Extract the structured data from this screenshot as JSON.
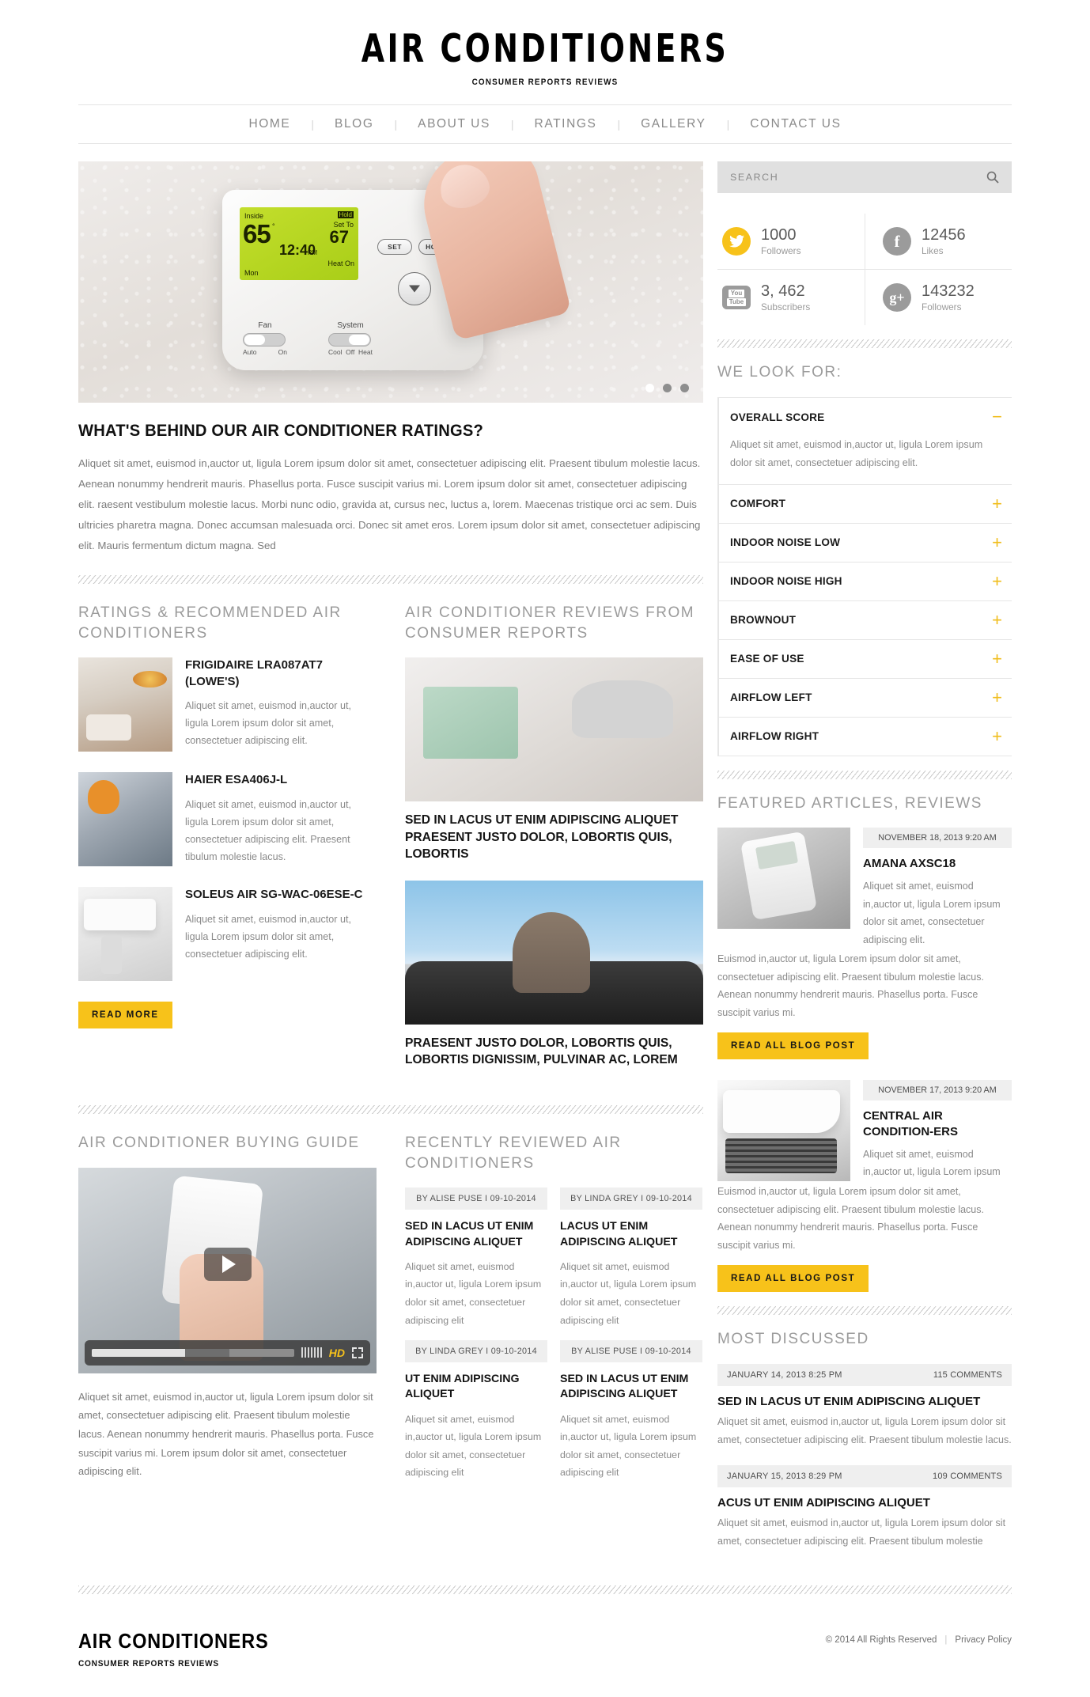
{
  "site": {
    "title": "AIR CONDITIONERS",
    "tagline": "CONSUMER REPORTS REVIEWS"
  },
  "nav": {
    "items": [
      {
        "label": "HOME"
      },
      {
        "label": "BLOG"
      },
      {
        "label": "ABOUT US"
      },
      {
        "label": "RATINGS"
      },
      {
        "label": "GALLERY"
      },
      {
        "label": "CONTACT US"
      }
    ],
    "separator": "|"
  },
  "slider": {
    "thermostat": {
      "inside_label": "Inside",
      "inside_temp": "65",
      "degree": "°",
      "time": "12:40",
      "meridiem": "PM",
      "hold": "Hold",
      "set_to_label": "Set To",
      "set_temp": "67",
      "heat_status": "Heat On",
      "day": "Mon",
      "btn_set": "SET",
      "btn_hold": "HOLD",
      "fan_label": "Fan",
      "fan_options": [
        "Auto",
        "On"
      ],
      "system_label": "System",
      "system_options": [
        "Cool",
        "Off",
        "Heat"
      ]
    },
    "dots": [
      {
        "active": true
      },
      {
        "active": false
      },
      {
        "active": false
      }
    ]
  },
  "intro": {
    "heading": "WHAT'S BEHIND OUR AIR CONDITIONER RATINGS?",
    "body": "Aliquet sit amet, euismod in,auctor ut, ligula Lorem ipsum dolor sit amet, consectetuer adipiscing elit. Praesent tibulum molestie lacus. Aenean nonummy hendrerit mauris. Phasellus porta. Fusce suscipit varius mi. Lorem ipsum dolor sit amet, consectetuer adipiscing elit. raesent vestibulum molestie lacus. Morbi nunc odio, gravida at, cursus nec, luctus a, lorem. Maecenas tristique orci ac sem. Duis ultricies pharetra magna. Donec accumsan malesuada orci. Donec sit amet eros. Lorem ipsum dolor sit amet, consectetuer adipiscing elit. Mauris fermentum dictum magna. Sed"
  },
  "ratings": {
    "heading": "RATINGS & RECOMMENDED AIR CONDITIONERS",
    "items": [
      {
        "title": "FRIGIDAIRE LRA087AT7 (LOWE'S)",
        "desc": "Aliquet sit amet, euismod in,auctor ut, ligula Lorem ipsum dolor sit amet, consectetuer adipiscing elit."
      },
      {
        "title": "HAIER ESA406J-L",
        "desc": "Aliquet sit amet, euismod in,auctor ut, ligula Lorem ipsum dolor sit amet, consectetuer adipiscing elit. Praesent tibulum molestie lacus."
      },
      {
        "title": "SOLEUS AIR SG-WAC-06ESE-C",
        "desc": "Aliquet sit amet, euismod in,auctor ut, ligula Lorem ipsum dolor sit amet, consectetuer adipiscing elit."
      }
    ],
    "read_more": "READ MORE"
  },
  "reviews": {
    "heading": "AIR CONDITIONER REVIEWS FROM CONSUMER REPORTS",
    "items": [
      {
        "title": "SED IN LACUS UT ENIM ADIPISCING ALIQUET PRAESENT JUSTO DOLOR, LOBORTIS QUIS, LOBORTIS"
      },
      {
        "title": "PRAESENT JUSTO DOLOR, LOBORTIS QUIS, LOBORTIS DIGNISSIM, PULVINAR AC, LOREM"
      }
    ]
  },
  "buying_guide": {
    "heading": "AIR CONDITIONER BUYING GUIDE",
    "video": {
      "hd_badge": "HD",
      "progress_played": 46,
      "progress_buffered": 68
    },
    "body": "Aliquet sit amet, euismod in,auctor ut, ligula Lorem ipsum dolor sit amet, consectetuer adipiscing elit. Praesent tibulum molestie lacus. Aenean nonummy hendrerit mauris. Phasellus porta. Fusce suscipit varius mi. Lorem ipsum dolor sit amet, consectetuer adipiscing elit."
  },
  "recently_reviewed": {
    "heading": "RECENTLY REVIEWED AIR CONDITIONERS",
    "items": [
      {
        "meta": "BY ALISE PUSE I 09-10-2014",
        "title": "SED IN LACUS UT ENIM ADIPISCING ALIQUET",
        "desc": "Aliquet sit amet, euismod in,auctor ut, ligula Lorem ipsum dolor sit amet, consectetuer adipiscing elit"
      },
      {
        "meta": "BY LINDA GREY I 09-10-2014",
        "title": "LACUS UT ENIM ADIPISCING ALIQUET",
        "desc": "Aliquet sit amet, euismod in,auctor ut, ligula Lorem ipsum dolor sit amet, consectetuer adipiscing elit"
      },
      {
        "meta": "BY LINDA GREY I 09-10-2014",
        "title": "UT ENIM ADIPISCING ALIQUET",
        "desc": "Aliquet sit amet, euismod in,auctor ut, ligula Lorem ipsum dolor sit amet, consectetuer adipiscing elit"
      },
      {
        "meta": "BY ALISE PUSE I 09-10-2014",
        "title": "SED IN LACUS UT ENIM ADIPISCING ALIQUET",
        "desc": "Aliquet sit amet, euismod in,auctor ut, ligula Lorem ipsum dolor sit amet, consectetuer adipiscing elit"
      }
    ]
  },
  "search": {
    "placeholder": "SEARCH",
    "value": "",
    "icon": "search-icon"
  },
  "social": [
    {
      "network": "twitter",
      "icon": "twitter-icon",
      "count": "1000",
      "label": "Followers",
      "color": "#f7c21a",
      "glyph": "🐦"
    },
    {
      "network": "facebook",
      "icon": "facebook-icon",
      "count": "12456",
      "label": "Likes",
      "color": "#9b9b9b",
      "glyph": "f"
    },
    {
      "network": "youtube",
      "icon": "youtube-icon",
      "count": "3, 462",
      "label": "Subscribers",
      "color": "#9b9b9b",
      "glyph": "You"
    },
    {
      "network": "googleplus",
      "icon": "google-plus-icon",
      "count": "143232",
      "label": "Followers",
      "color": "#9b9b9b",
      "glyph": "g+"
    }
  ],
  "we_look_for": {
    "heading": "WE LOOK FOR:",
    "items": [
      {
        "title": "OVERALL SCORE",
        "open": true,
        "sign": "−",
        "body": "Aliquet sit amet, euismod in,auctor ut, ligula Lorem ipsum dolor sit amet, consectetuer adipiscing elit."
      },
      {
        "title": "COMFORT",
        "open": false,
        "sign": "+",
        "body": ""
      },
      {
        "title": "INDOOR NOISE LOW",
        "open": false,
        "sign": "+",
        "body": ""
      },
      {
        "title": "INDOOR NOISE HIGH",
        "open": false,
        "sign": "+",
        "body": ""
      },
      {
        "title": "BROWNOUT",
        "open": false,
        "sign": "+",
        "body": ""
      },
      {
        "title": "EASE OF USE",
        "open": false,
        "sign": "+",
        "body": ""
      },
      {
        "title": "AIRFLOW LEFT",
        "open": false,
        "sign": "+",
        "body": ""
      },
      {
        "title": "AIRFLOW RIGHT",
        "open": false,
        "sign": "+",
        "body": ""
      }
    ]
  },
  "featured": {
    "heading": "FEATURED ARTICLES, REVIEWS",
    "items": [
      {
        "date": "NOVEMBER 18, 2013 9:20 AM",
        "title": "AMANA AXSC18",
        "excerpt": "Aliquet sit amet, euismod in,auctor ut, ligula Lorem ipsum dolor sit amet, consectetuer adipiscing elit.",
        "more": "Euismod in,auctor ut, ligula Lorem ipsum dolor sit amet, consectetuer adipiscing elit. Praesent tibulum molestie lacus. Aenean nonummy hendrerit mauris. Phasellus porta. Fusce suscipit varius mi.",
        "button": "READ ALL BLOG POST"
      },
      {
        "date": "NOVEMBER 17, 2013 9:20 AM",
        "title": "CENTRAL AIR CONDITION-ERS",
        "excerpt": "Aliquet sit amet, euismod in,auctor ut, ligula Lorem ipsum",
        "more": "Euismod in,auctor ut, ligula Lorem ipsum dolor sit amet, consectetuer adipiscing elit. Praesent tibulum molestie lacus. Aenean nonummy hendrerit mauris. Phasellus porta. Fusce suscipit varius mi.",
        "button": "READ ALL BLOG POST"
      }
    ]
  },
  "most_discussed": {
    "heading": "MOST DISCUSSED",
    "items": [
      {
        "date": "JANUARY 14, 2013 8:25 PM",
        "comments": "115 COMMENTS",
        "title": "SED IN LACUS UT ENIM ADIPISCING ALIQUET",
        "desc": "Aliquet sit amet, euismod in,auctor ut, ligula Lorem ipsum dolor sit amet, consectetuer adipiscing elit. Praesent tibulum molestie lacus."
      },
      {
        "date": "JANUARY 15, 2013 8:29 PM",
        "comments": "109 COMMENTS",
        "title": "ACUS UT ENIM ADIPISCING ALIQUET",
        "desc": "Aliquet sit amet, euismod in,auctor ut, ligula Lorem ipsum dolor sit amet, consectetuer adipiscing elit. Praesent tibulum molestie"
      }
    ]
  },
  "footer": {
    "logo": "AIR CONDITIONERS",
    "tagline": "CONSUMER REPORTS REVIEWS",
    "copyright": "© 2014 All Rights Reserved",
    "separator": "|",
    "privacy": "Privacy Policy"
  },
  "theme": {
    "accent": "#f7c21a",
    "text_dark": "#141414",
    "text_muted": "#8a8a8a",
    "panel_gray": "#efefef"
  }
}
